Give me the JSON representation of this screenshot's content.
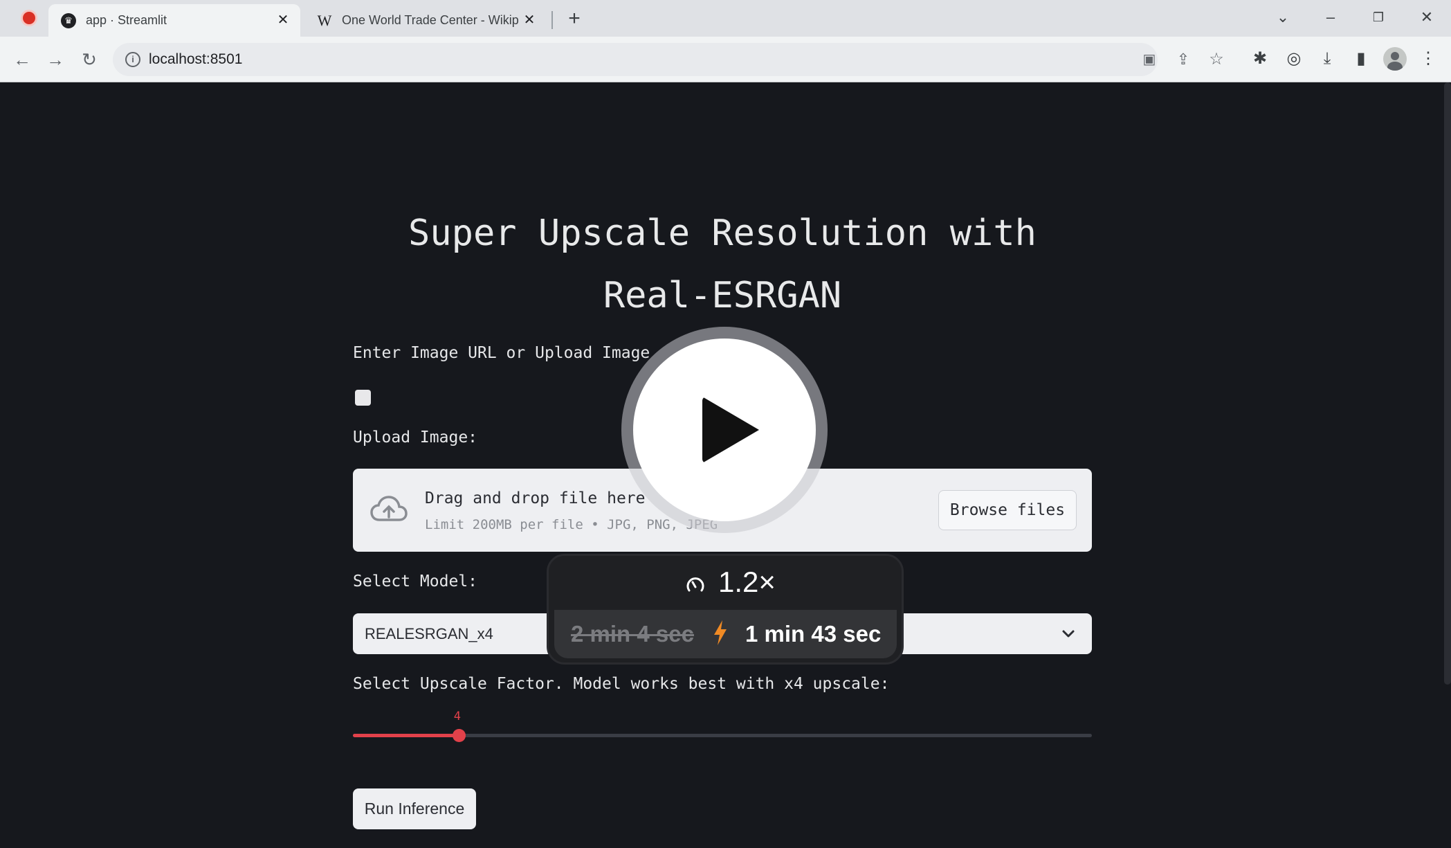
{
  "browser": {
    "tabs": [
      {
        "title": "app · Streamlit",
        "favicon": "streamlit-crown-icon",
        "active": true
      },
      {
        "title": "One World Trade Center - Wikip",
        "favicon": "wikipedia-w-icon",
        "active": false
      }
    ],
    "url": "localhost:8501"
  },
  "app": {
    "title": "Super Upscale Resolution with Real-ESRGAN",
    "source_label": "Enter Image URL or Upload Image",
    "upload_label": "Upload Image:",
    "dropzone": {
      "title": "Drag and drop file here",
      "limit": "Limit 200MB per file • JPG, PNG, JPEG",
      "browse_label": "Browse files"
    },
    "model_label": "Select Model:",
    "model_value": "REALESRGAN_x4",
    "upscale_label": "Select Upscale Factor. Model works best with x4 upscale:",
    "upscale_value": "4",
    "upscale_fraction": 0.143,
    "run_label": "Run Inference"
  },
  "overlay": {
    "speed": "1.2×",
    "original_duration": "2 min 4 sec",
    "new_duration": "1 min 43 sec"
  },
  "colors": {
    "accent": "#e2414a",
    "page_bg": "#16181d",
    "play_bg": "#ffffff"
  }
}
